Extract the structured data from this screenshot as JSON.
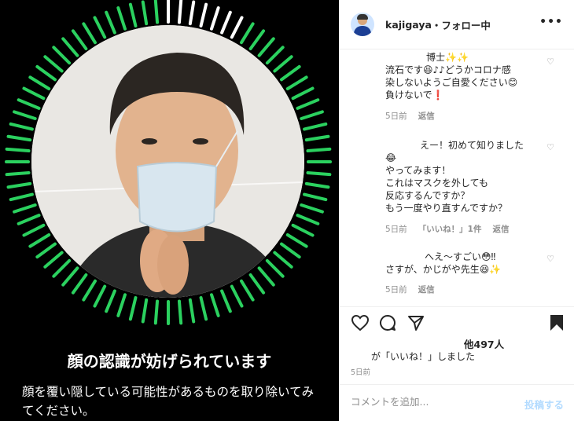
{
  "media": {
    "title": "顔の認識が妨げられています",
    "body": "顔を覆い隠している可能性があるものを取り除いてみてください。"
  },
  "header": {
    "username": "kajigaya",
    "follow": "・フォロー中",
    "more": "•••"
  },
  "comments": [
    {
      "lines": [
        "博士✨✨",
        "流石です😆♪♪どうかコロナ感",
        "染しないようご自愛ください😊",
        "負けないで❗"
      ],
      "time": "5日前",
      "reply": "返信",
      "likes": ""
    },
    {
      "lines": [
        "えー！初めて知りました",
        "😂",
        "やってみます！",
        "これはマスクを外しても",
        "反応するんですか？",
        "もう一度やり直すんですか？"
      ],
      "time": "5日前",
      "likes": "「いいね！」1件",
      "reply": "返信"
    },
    {
      "lines": [
        "へえ〜すごい😳‼",
        "さすが、かじがや先生😆✨"
      ],
      "time": "5日前",
      "reply": "返信",
      "likes": ""
    }
  ],
  "icons": {
    "like": "heart-icon",
    "comment": "comment-icon",
    "share": "share-icon",
    "save": "bookmark-icon"
  },
  "post": {
    "likes_count": "他497人",
    "liked_by": "が「いいね！」しました",
    "time": "5日前"
  },
  "composer": {
    "placeholder": "コメントを追加...",
    "post_label": "投稿する"
  },
  "colors": {
    "ring_active": "#2bd15f",
    "ring_inactive": "#ffffff",
    "link": "#b3dbff"
  }
}
